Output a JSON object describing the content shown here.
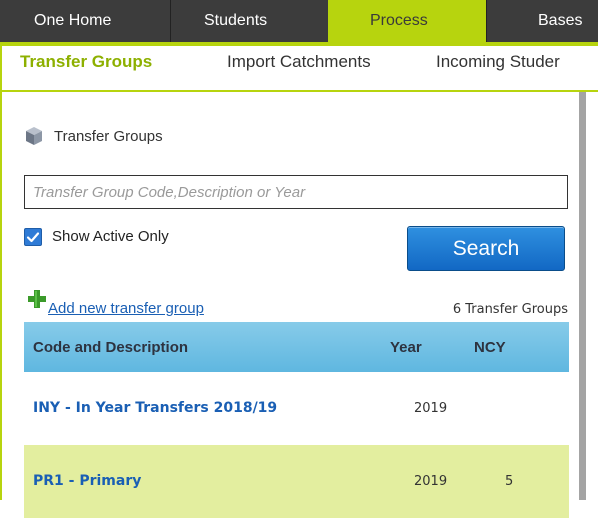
{
  "topnav": {
    "tabs": [
      {
        "label": "One Home",
        "active": false
      },
      {
        "label": "Students",
        "active": false
      },
      {
        "label": "Process",
        "active": true
      },
      {
        "label": "Bases",
        "active": false
      }
    ]
  },
  "subnav": {
    "items": [
      {
        "label": "Transfer Groups",
        "active": true
      },
      {
        "label": "Import Catchments",
        "active": false
      },
      {
        "label": "Incoming Studer",
        "active": false
      }
    ]
  },
  "panel": {
    "title": "Transfer Groups",
    "icon": "cube-icon"
  },
  "search": {
    "placeholder": "Transfer Group Code,Description or Year",
    "value": "",
    "show_active_label": "Show Active Only",
    "show_active_checked": true,
    "button_label": "Search"
  },
  "actions": {
    "add_label": "Add new transfer group",
    "count_label": "6 Transfer Groups"
  },
  "table": {
    "headers": {
      "code": "Code and Description",
      "year": "Year",
      "ncy": "NCY"
    },
    "rows": [
      {
        "code": "INY - In Year Transfers 2018/19",
        "year": "2019",
        "ncy": ""
      },
      {
        "code": "PR1 - Primary",
        "year": "2019",
        "ncy": "5"
      }
    ]
  },
  "colors": {
    "accent": "#b7d40e",
    "nav_bg": "#3c3c3c",
    "link": "#1a5fb4",
    "header_bg": "#6cbde3",
    "alt_row": "#e3ee9f",
    "button": "#1a78d0"
  }
}
